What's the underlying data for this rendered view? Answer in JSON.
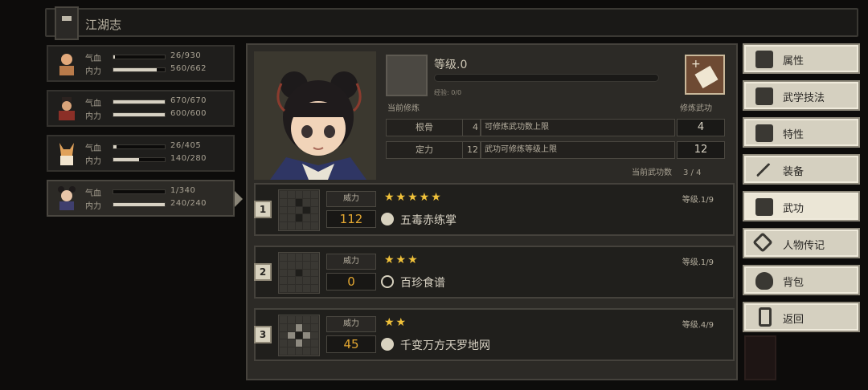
{
  "topbar": {
    "title": "江湖志"
  },
  "party": [
    {
      "hp_label": "气血",
      "hp": "26/930",
      "hp_fill": 0.03,
      "mp_label": "内力",
      "mp": "560/662",
      "mp_fill": 0.85
    },
    {
      "hp_label": "气血",
      "hp": "670/670",
      "hp_fill": 1.0,
      "mp_label": "内力",
      "mp": "600/600",
      "mp_fill": 1.0
    },
    {
      "hp_label": "气血",
      "hp": "26/405",
      "hp_fill": 0.06,
      "mp_label": "内力",
      "mp": "140/280",
      "mp_fill": 0.5
    },
    {
      "hp_label": "气血",
      "hp": "1/340",
      "hp_fill": 0.0,
      "mp_label": "内力",
      "mp": "240/240",
      "mp_fill": 1.0
    }
  ],
  "cultivation": {
    "level_label": "等级.0",
    "exp_label": "经验: 0/0",
    "current_label": "当前修炼",
    "skill_label": "修炼武功",
    "stats": [
      {
        "name": "根骨",
        "num": "4",
        "desc": "可修炼武功数上限",
        "value": "4"
      },
      {
        "name": "定力",
        "num": "12",
        "desc": "武功可修炼等级上限",
        "value": "12"
      }
    ],
    "count_label": "当前武功数",
    "count_value": "3 / 4"
  },
  "arts": [
    {
      "index": "1",
      "power_label": "威力",
      "stars": "★★★★★",
      "power": "112",
      "name": "五毒赤练掌",
      "level": "等级.1/9"
    },
    {
      "index": "2",
      "power_label": "威力",
      "stars": "★★★",
      "power": "0",
      "name": "百珍食谱",
      "level": "等级.1/9"
    },
    {
      "index": "3",
      "power_label": "威力",
      "stars": "★★",
      "power": "45",
      "name": "千变万方天罗地网",
      "level": "等级.4/9"
    }
  ],
  "menu": [
    {
      "label": "属性"
    },
    {
      "label": "武学技法"
    },
    {
      "label": "特性"
    },
    {
      "label": "装备"
    },
    {
      "label": "武功"
    },
    {
      "label": "人物传记"
    },
    {
      "label": "背包"
    },
    {
      "label": "返回"
    }
  ]
}
